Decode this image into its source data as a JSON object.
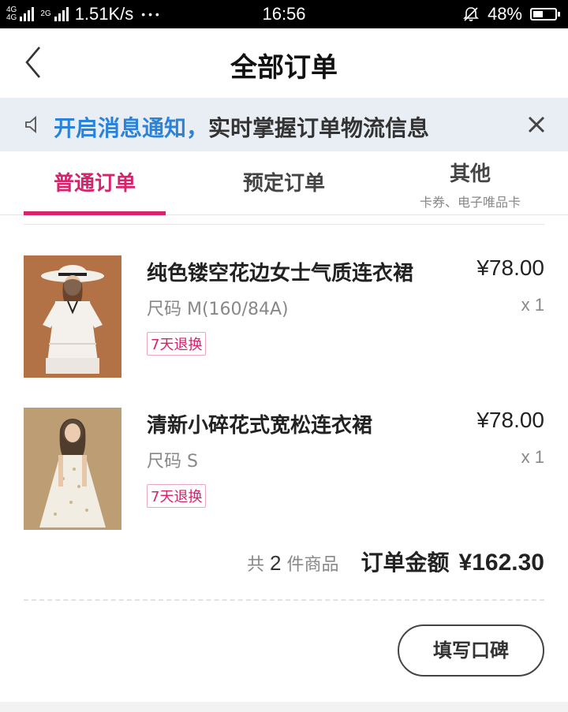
{
  "status_bar": {
    "net_a": "4G",
    "net_b": "4G",
    "net_c": "2G",
    "speed": "1.51K/s",
    "dots": "• • •",
    "time": "16:56",
    "battery": "48%",
    "battery_level": 0.48
  },
  "nav": {
    "title": "全部订单"
  },
  "notice": {
    "highlight": "开启消息通知，",
    "text": "实时掌握订单物流信息"
  },
  "tabs": [
    {
      "label": "普通订单"
    },
    {
      "label": "预定订单"
    },
    {
      "label": "其他",
      "sub": "卡券、电子唯品卡"
    }
  ],
  "products": [
    {
      "name": "纯色镂空花边女士气质连衣裙",
      "size": "尺码 M(160/84A)",
      "badge": "7天退换",
      "price": "¥78.00",
      "qty": "x 1"
    },
    {
      "name": "清新小碎花式宽松连衣裙",
      "size": "尺码 S",
      "badge": "7天退换",
      "price": "¥78.00",
      "qty": "x 1"
    }
  ],
  "summary": {
    "count_prefix": "共",
    "count": "2",
    "count_suffix": "件商品",
    "label": "订单金额",
    "amount": "¥162.30"
  },
  "actions": {
    "review": "填写口碑"
  },
  "colors": {
    "accent": "#d6236c",
    "notice_highlight": "#2b82d9",
    "notice_bg": "#e9eef4"
  }
}
